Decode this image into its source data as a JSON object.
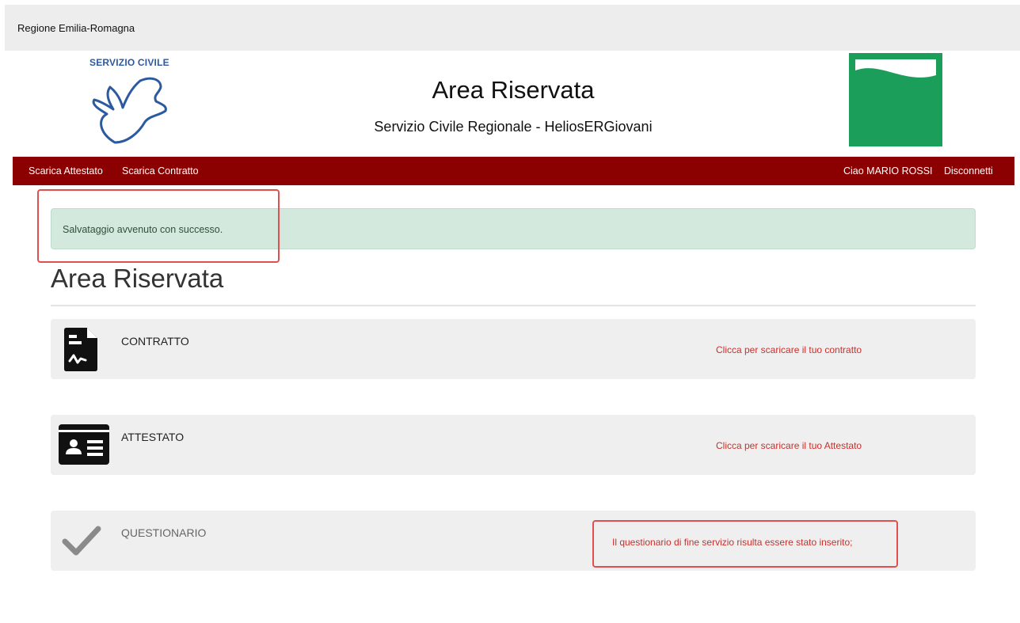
{
  "topbar": {
    "region": "Regione Emilia-Romagna"
  },
  "header": {
    "logo_label": "SERVIZIO CIVILE",
    "title": "Area Riservata",
    "subtitle": "Servizio Civile Regionale - HeliosERGiovani"
  },
  "navbar": {
    "left": [
      "Scarica Attestato",
      "Scarica Contratto"
    ],
    "greeting": "Ciao MARIO ROSSI",
    "logout": "Disconnetti"
  },
  "alert": {
    "message": "Salvataggio avvenuto con successo."
  },
  "main": {
    "title": "Area Riservata",
    "cards": [
      {
        "title": "CONTRATTO",
        "action": "Clicca per scaricare il tuo contratto",
        "icon": "document-icon"
      },
      {
        "title": "ATTESTATO",
        "action": "Clicca per scaricare il tuo Attestato",
        "icon": "id-card-icon"
      },
      {
        "title": "QUESTIONARIO",
        "note": "Il questionario di fine servizio risulta essere stato inserito;",
        "icon": "checkmark-icon"
      }
    ]
  },
  "colors": {
    "navbar": "#8b0000",
    "alert_bg": "#d4e9dd",
    "link_red": "#c9302c",
    "highlight_box": "#e05050",
    "brand_green": "#1a9e5a",
    "logo_blue": "#2c5aa0"
  }
}
